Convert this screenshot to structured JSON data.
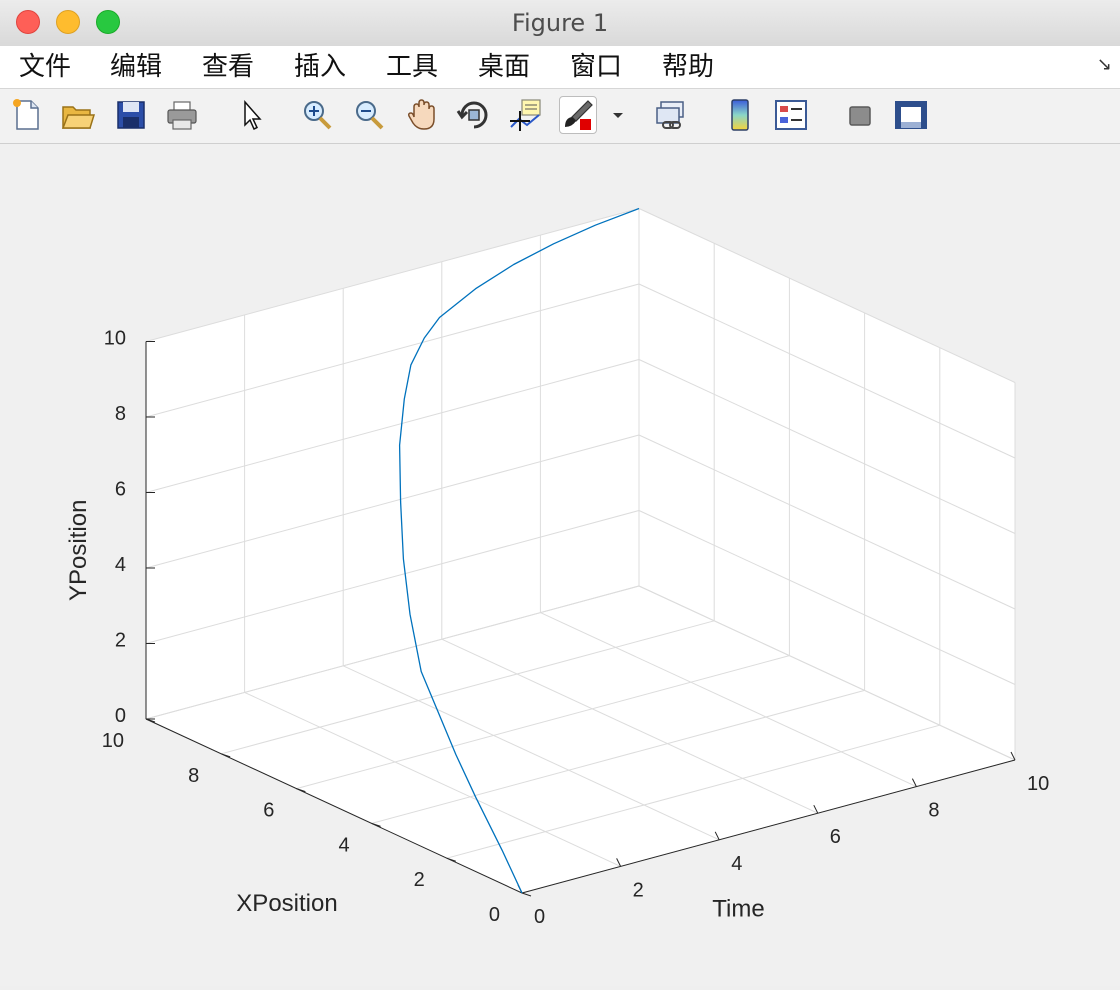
{
  "window": {
    "title": "Figure 1"
  },
  "menu": [
    "文件",
    "编辑",
    "查看",
    "插入",
    "工具",
    "桌面",
    "窗口",
    "帮助"
  ],
  "menu_corner": "↘",
  "toolbar": [
    "new-figure-icon",
    "open-file-icon",
    "save-icon",
    "print-icon",
    "pointer-icon",
    "zoom-in-icon",
    "zoom-out-icon",
    "pan-hand-icon",
    "rotate-3d-icon",
    "data-cursor-icon",
    "brush-icon",
    "dropdown-arrow-icon",
    "link-plot-icon",
    "colorbar-icon",
    "legend-icon",
    "hide-plot-tools-icon",
    "show-plot-tools-icon"
  ],
  "colors": {
    "line": "#0072bd",
    "grid": "#dcdcdc",
    "axis": "#262626"
  },
  "chart_data": {
    "type": "line",
    "view": "3d",
    "xlabel": "Time",
    "ylabel": "XPosition",
    "zlabel": "YPosition",
    "xlim": [
      0,
      10
    ],
    "ylim": [
      0,
      10
    ],
    "zlim": [
      0,
      10
    ],
    "xticks": [
      "0",
      "2",
      "4",
      "6",
      "8",
      "10"
    ],
    "yticks": [
      "0",
      "2",
      "4",
      "6",
      "8",
      "10"
    ],
    "zticks": [
      "0",
      "2",
      "4",
      "6",
      "8",
      "10"
    ],
    "grid": true,
    "series": [
      {
        "color": "#0072bd",
        "points": [
          [
            0.0,
            0.0,
            0.0
          ],
          [
            0.3,
            0.92,
            0.6
          ],
          [
            0.7,
            2.15,
            1.3
          ],
          [
            1.0,
            3.07,
            1.9
          ],
          [
            1.3,
            3.95,
            2.55
          ],
          [
            1.6,
            4.78,
            3.1
          ],
          [
            2.0,
            5.6,
            4.1
          ],
          [
            2.4,
            6.3,
            5.1
          ],
          [
            2.8,
            6.9,
            6.2
          ],
          [
            3.2,
            7.45,
            7.3
          ],
          [
            3.6,
            7.85,
            8.2
          ],
          [
            4.0,
            8.2,
            8.8
          ],
          [
            4.5,
            8.5,
            9.2
          ],
          [
            5.0,
            8.75,
            9.45
          ],
          [
            6.0,
            9.1,
            9.7
          ],
          [
            7.0,
            9.4,
            9.85
          ],
          [
            8.0,
            9.65,
            9.93
          ],
          [
            9.0,
            9.85,
            9.98
          ],
          [
            10.0,
            10.0,
            10.0
          ]
        ]
      }
    ]
  }
}
